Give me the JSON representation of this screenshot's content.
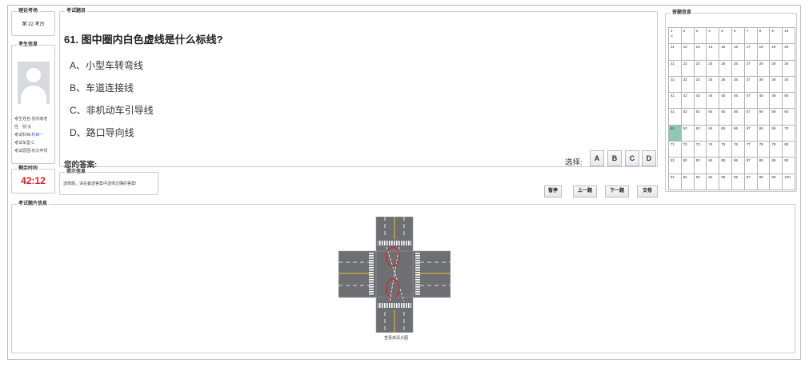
{
  "exam_room": {
    "legend": "理论考场",
    "value": "第 22 考台"
  },
  "candidate": {
    "legend": "考生信息",
    "fields": [
      {
        "label": "考生姓名:",
        "value": "张欣雨老"
      },
      {
        "label": "性　别:",
        "value": "女"
      },
      {
        "label": "考试科目:",
        "value": "科目一"
      },
      {
        "label": "考试车型:",
        "value": "C"
      },
      {
        "label": "考试原因:",
        "value": "初次申领"
      }
    ]
  },
  "timer": {
    "legend": "剩余时间",
    "value": "42:12"
  },
  "question": {
    "legend": "考试题目",
    "title": "61. 图中圈内白色虚线是什么标线?",
    "options": [
      "A、小型车转弯线",
      "B、车道连接线",
      "C、非机动车引导线",
      "D、路口导向线"
    ],
    "answer_label": "您的答案:",
    "choose_label": "选择:",
    "choices": [
      "A",
      "B",
      "C",
      "D"
    ]
  },
  "hint": {
    "legend": "提示信息",
    "text": "选择题，请在备选答案中选择正确的答案!"
  },
  "nav_buttons": [
    "暂停",
    "上一题",
    "下一题",
    "交卷"
  ],
  "answer_grid": {
    "legend": "答题信息",
    "current": 61,
    "marks": {
      "1": "×"
    },
    "current_color": "#8fc9b3"
  },
  "image_panel": {
    "legend": "考试题片信息",
    "caption": "查看高清大图"
  },
  "colors": {
    "timer": "#e02020",
    "blue_text": "#2d4fd0"
  }
}
